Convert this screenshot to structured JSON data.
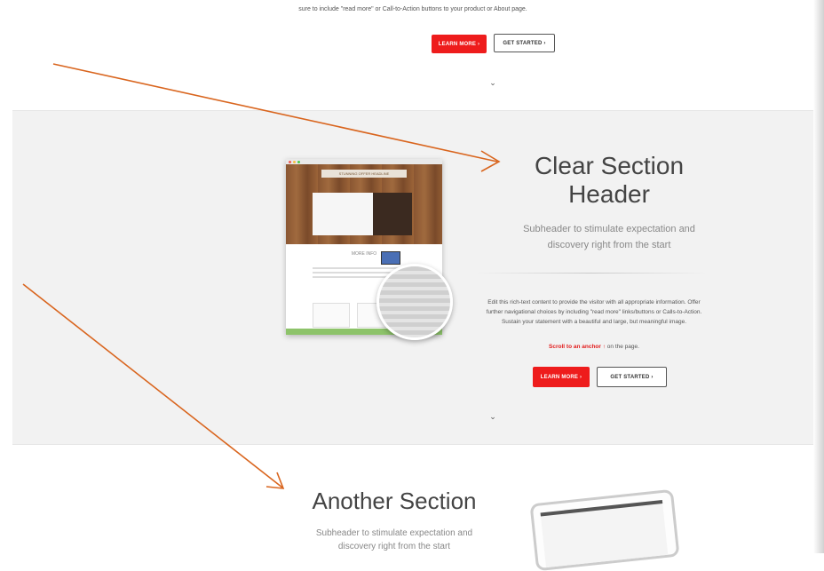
{
  "top_section": {
    "text": "sure to include \"read more\" or Call-to-Action buttons to your product or About page.",
    "learn_more": "LEARN MORE ›",
    "get_started": "GET STARTED ›",
    "chevron": "⌄"
  },
  "clear_section": {
    "title_line1": "Clear Section",
    "title_line2": "Header",
    "sub_line1": "Subheader to stimulate expectation and",
    "sub_line2": "discovery right from the start",
    "body_line1": "Edit this rich-text content to provide the visitor with all appropriate information. Offer",
    "body_line2": "further navigational choices by including \"read more\" links/buttons or Calls-to-Action.",
    "body_line3": "Sustain your statement with a beautiful and large, but meaningful image.",
    "anchor_link": "Scroll to an anchor ↑",
    "anchor_suffix": " on the page.",
    "learn_more": "LEARN MORE ›",
    "get_started": "GET STARTED ›",
    "chevron": "⌄",
    "mockup": {
      "banner": "STUNNING OFFER HEADLINE",
      "info_title": "MORE INFO"
    }
  },
  "another_section": {
    "title": "Another Section",
    "sub_line1": "Subheader to stimulate expectation and",
    "sub_line2": "discovery right from the start"
  },
  "colors": {
    "accent_red": "#ee1c1c",
    "arrow_orange": "#d9651e",
    "gray_bg": "#f2f2f2"
  },
  "icons": {
    "chevron": "chevron-down-icon",
    "laptop": "laptop-icon",
    "magnifier": "magnifier-icon"
  }
}
